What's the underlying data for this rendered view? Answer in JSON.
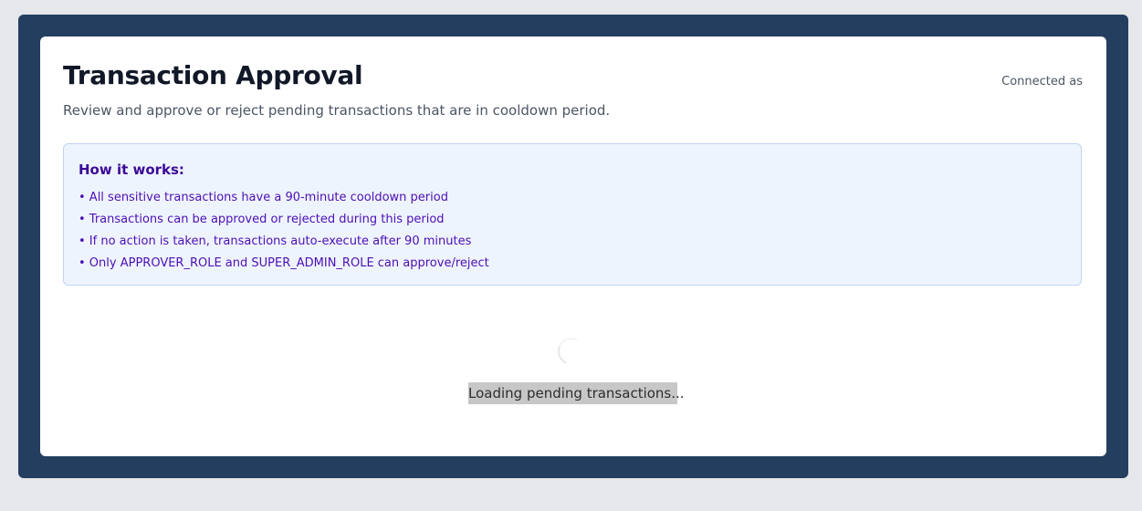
{
  "header": {
    "title": "Transaction Approval",
    "subtitle": "Review and approve or reject pending transactions that are in cooldown period.",
    "connected_label": "Connected as"
  },
  "info_box": {
    "title": "How it works:",
    "items": [
      "• All sensitive transactions have a 90-minute cooldown period",
      "• Transactions can be approved or rejected during this period",
      "• If no action is taken, transactions auto-execute after 90 minutes",
      "• Only APPROVER_ROLE and SUPER_ADMIN_ROLE can approve/reject"
    ]
  },
  "loading": {
    "text": "Loading pending transactions..."
  },
  "colors": {
    "page_background": "#e5e7eb",
    "frame_background": "#243e5f",
    "card_background": "#ffffff",
    "info_background": "#eef4fd",
    "info_border": "#bfd4f2",
    "info_text": "#4c0fb5"
  }
}
